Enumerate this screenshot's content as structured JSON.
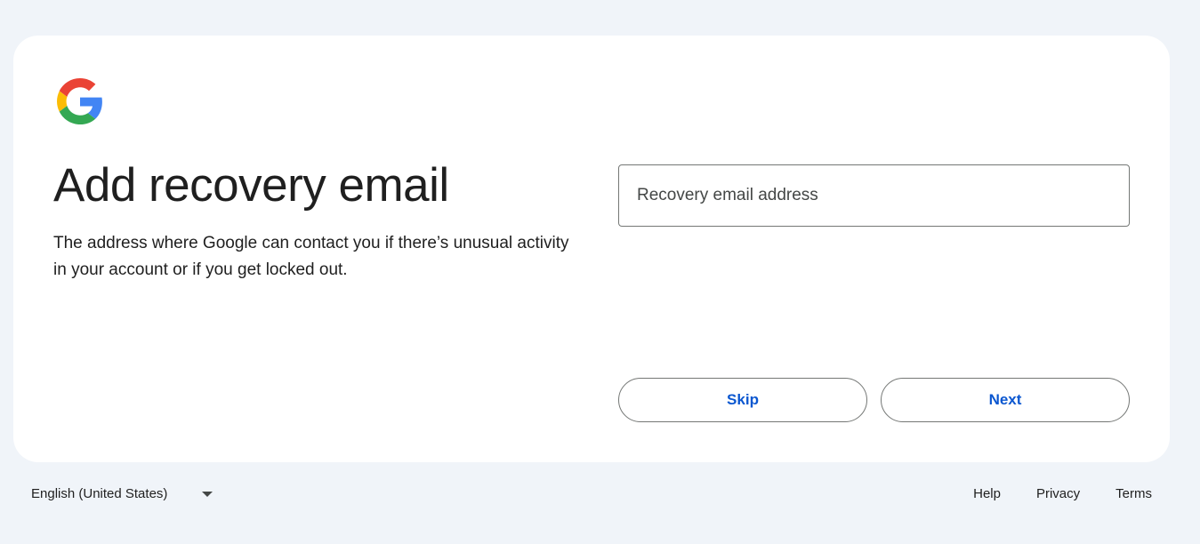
{
  "logo": {
    "icon": "google-g-icon",
    "colors": [
      "#4285F4",
      "#34A853",
      "#FBBC05",
      "#EA4335"
    ]
  },
  "main": {
    "title": "Add recovery email",
    "description": "The address where Google can contact you if there’s unusual activity in your account or if you get locked out."
  },
  "email_field": {
    "placeholder": "Recovery email address",
    "value": ""
  },
  "actions": {
    "skip_label": "Skip",
    "next_label": "Next"
  },
  "footer": {
    "language": "English (United States)",
    "language_icon": "caret-down-icon",
    "links": {
      "help": "Help",
      "privacy": "Privacy",
      "terms": "Terms"
    }
  },
  "colors": {
    "background": "#f0f4f9",
    "card": "#ffffff",
    "accent": "#0b57d0",
    "text": "#1f1f1f"
  }
}
